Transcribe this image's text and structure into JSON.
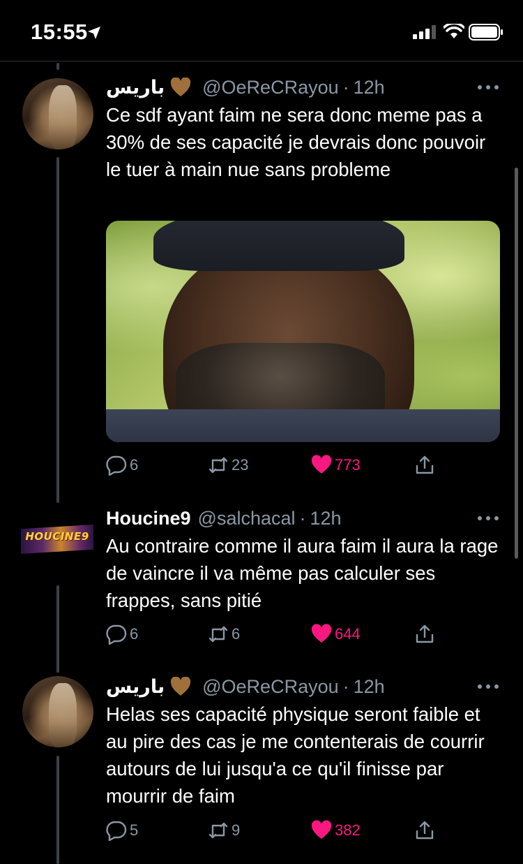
{
  "status_bar": {
    "time": "15:55"
  },
  "tweets": [
    {
      "name": "باريس",
      "handle": "@OeReCRayou",
      "time": "12h",
      "text": "Ce sdf ayant faim ne sera donc meme pas a 30% de ses capacité je devrais donc pouvoir le tuer à main nue sans probleme",
      "has_media": true,
      "replies": "6",
      "retweets": "23",
      "likes": "773"
    },
    {
      "name": "Houcine9",
      "handle": "@salchacal",
      "time": "12h",
      "avatar_text": "HOUCINE9",
      "text": "Au contraire comme il aura faim il aura la rage de vaincre il va même pas calculer ses frappes, sans pitié",
      "replies": "6",
      "retweets": "6",
      "likes": "644"
    },
    {
      "name": "باريس",
      "handle": "@OeReCRayou",
      "time": "12h",
      "text": "Helas ses capacité physique seront faible et au pire des cas je me contenterais de courrir autours de lui jusqu'a ce qu'il finisse par mourrir de faim",
      "replies": "5",
      "retweets": "9",
      "likes": "382"
    }
  ],
  "colors": {
    "background": "#000000",
    "secondary_text": "#8b98a5",
    "like_active": "#f91880",
    "heart_emoji": "#a0703a"
  }
}
